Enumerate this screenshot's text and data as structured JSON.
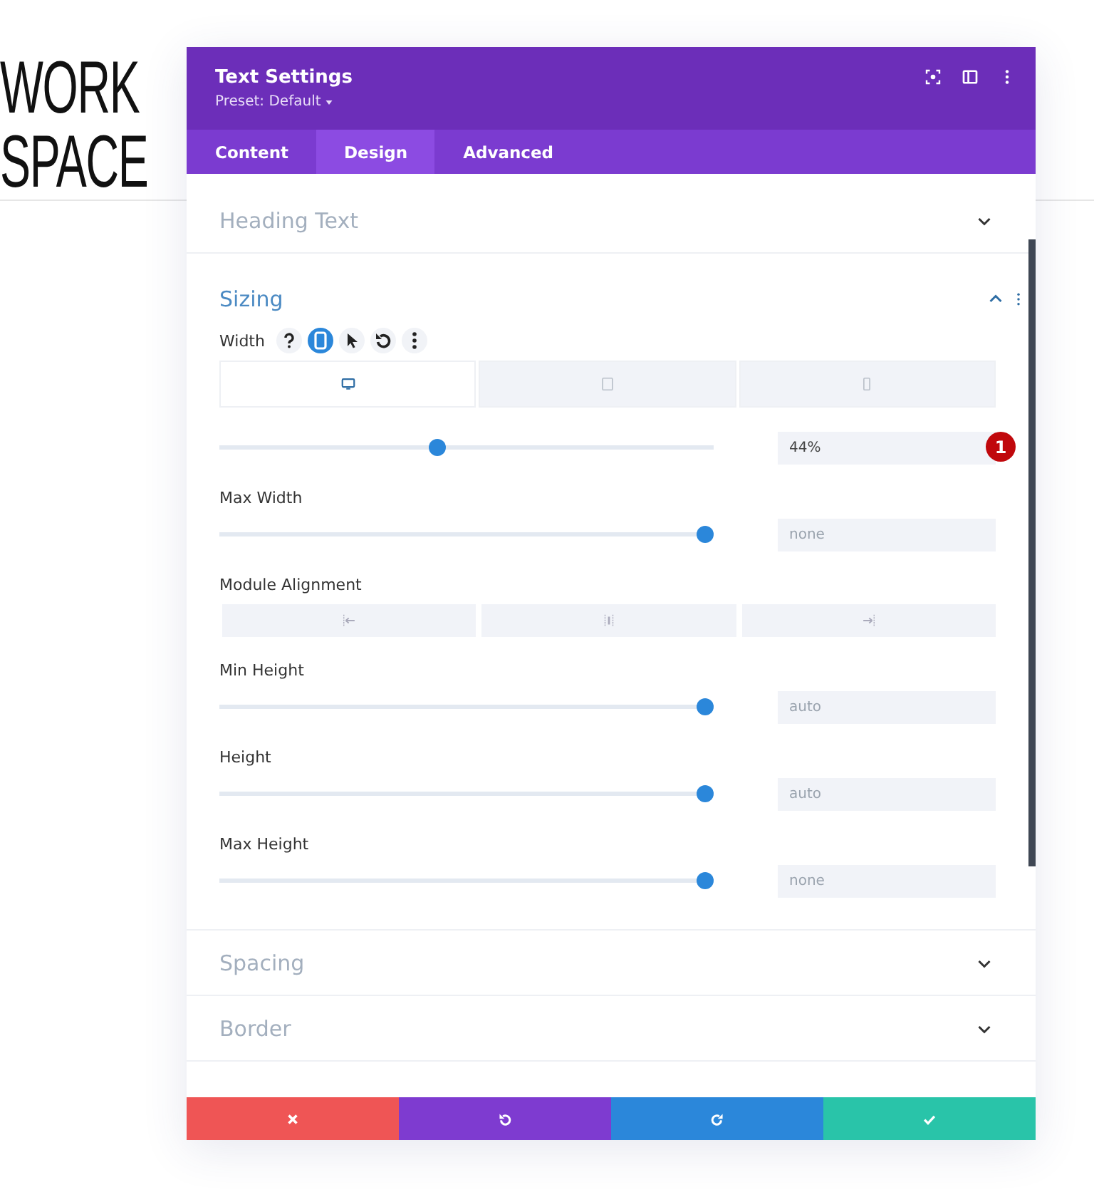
{
  "backdrop": {
    "title_lines": [
      "WORK",
      "SPACE"
    ]
  },
  "panel": {
    "title": "Text Settings",
    "preset": "Preset: Default",
    "tabs": [
      {
        "label": "Content",
        "selected": false
      },
      {
        "label": "Design",
        "selected": true
      },
      {
        "label": "Advanced",
        "selected": false
      }
    ],
    "sections": [
      {
        "title": "Heading Text",
        "expanded": false
      },
      {
        "title": "Sizing",
        "expanded": true,
        "fields": [
          {
            "kind": "responsive",
            "label": "Width",
            "devices": [
              {
                "selected": true
              },
              {
                "selected": false
              },
              {
                "selected": false
              }
            ],
            "level": 0.44,
            "value": "44%",
            "badge": "1"
          },
          {
            "kind": "slider",
            "label": "Max Width",
            "level": 1,
            "placeholder": "none"
          },
          {
            "kind": "alignment",
            "label": "Module Alignment"
          },
          {
            "kind": "slider",
            "label": "Min Height",
            "level": 1,
            "placeholder": "auto"
          },
          {
            "kind": "slider",
            "label": "Height",
            "level": 1,
            "placeholder": "auto"
          },
          {
            "kind": "slider",
            "label": "Max Height",
            "level": 1,
            "placeholder": "none"
          }
        ]
      },
      {
        "title": "Spacing",
        "expanded": false
      },
      {
        "title": "Border",
        "expanded": false
      }
    ]
  }
}
